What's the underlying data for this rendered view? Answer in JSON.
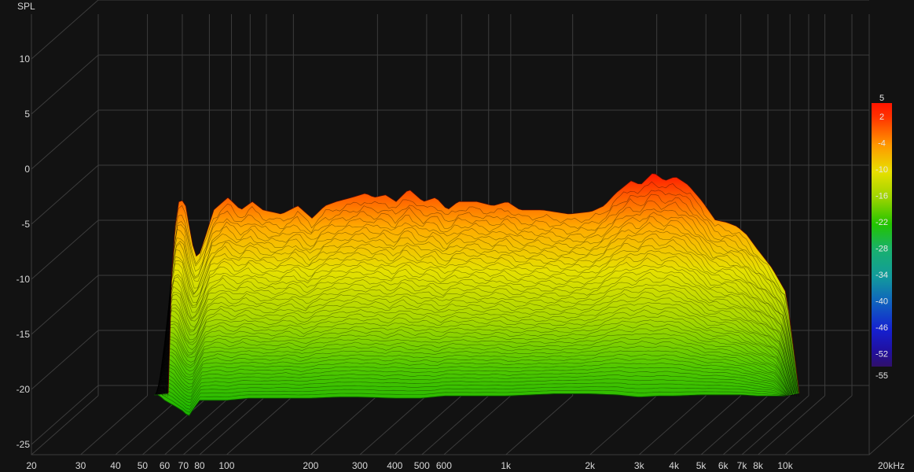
{
  "chart_data": {
    "type": "area",
    "subtype": "waterfall",
    "ylabel": "SPL",
    "x_scale": "log",
    "xlim": [
      20,
      20000
    ],
    "x_ticks": [
      20,
      30,
      40,
      50,
      60,
      70,
      80,
      100,
      200,
      300,
      400,
      500,
      600,
      1000,
      2000,
      3000,
      4000,
      5000,
      6000,
      7000,
      8000,
      10000,
      20000
    ],
    "x_tick_labels": [
      "20",
      "30",
      "40",
      "50",
      "60",
      "70",
      "80",
      "100",
      "200",
      "300",
      "400",
      "500",
      "600",
      "1k",
      "2k",
      "3k",
      "4k",
      "5k",
      "6k",
      "7k",
      "8k",
      "10k",
      "20kHz"
    ],
    "ylim": [
      -25,
      10
    ],
    "y_ticks": [
      10,
      5,
      0,
      -5,
      -10,
      -15,
      -20,
      -25
    ],
    "y_tick_labels": [
      "10",
      "5",
      "0",
      "-5",
      "-10",
      "-15",
      "-20",
      "-25"
    ],
    "frequency_range": [
      55,
      10000
    ],
    "grid": true,
    "colorbar": {
      "position": "right",
      "labels": [
        "5",
        "2",
        "-4",
        "-10",
        "-16",
        "-22",
        "-28",
        "-34",
        "-40",
        "-46",
        "-52",
        "-55"
      ],
      "values": [
        5,
        2,
        -4,
        -10,
        -16,
        -22,
        -28,
        -34,
        -40,
        -46,
        -52,
        -55
      ],
      "colors": [
        "#ff1500",
        "#ff5500",
        "#ffb000",
        "#e5e000",
        "#9bd400",
        "#22c400",
        "#18b070",
        "#129a9c",
        "#1060bf",
        "#1520d0",
        "#2010a0",
        "#30106a"
      ]
    },
    "front_slice": {
      "frequencies": [
        55,
        57,
        60,
        65,
        70,
        73,
        75,
        80,
        90,
        100,
        120,
        150,
        200,
        250,
        300,
        400,
        500,
        600,
        800,
        1000,
        1500,
        2000,
        2500,
        3000,
        3500,
        4000,
        5000,
        6000,
        7000,
        8000,
        10000
      ],
      "spl": [
        -20.5,
        -20.5,
        -21.0,
        -21.5,
        -22.0,
        -22.5,
        -22.0,
        -21.0,
        -21.0,
        -21.0,
        -20.8,
        -20.8,
        -20.8,
        -20.7,
        -20.7,
        -20.8,
        -20.8,
        -20.6,
        -20.6,
        -20.6,
        -20.4,
        -20.4,
        -20.5,
        -20.7,
        -20.6,
        -20.6,
        -20.5,
        -20.5,
        -20.5,
        -20.6,
        -20.6
      ]
    },
    "back_slice": {
      "frequencies": [
        55,
        57,
        60,
        63,
        67,
        70,
        75,
        80,
        90,
        100,
        110,
        120,
        140,
        160,
        180,
        200,
        220,
        250,
        280,
        300,
        330,
        360,
        400,
        450,
        500,
        550,
        600,
        700,
        800,
        900,
        1000,
        1200,
        1500,
        1800,
        2000,
        2200,
        2500,
        2700,
        3000,
        3300,
        3600,
        4000,
        4500,
        5000,
        5500,
        6000,
        6500,
        7000,
        8000,
        9000,
        10000
      ],
      "spl": [
        -20.0,
        -2.0,
        3.0,
        3.2,
        -2.0,
        -4.0,
        -1.0,
        2.0,
        3.5,
        2.0,
        3.0,
        2.0,
        1.5,
        2.5,
        1.0,
        2.5,
        3.0,
        3.5,
        4.0,
        3.5,
        3.8,
        3.0,
        4.5,
        3.0,
        3.5,
        2.0,
        3.0,
        3.0,
        2.5,
        3.0,
        2.0,
        2.0,
        1.5,
        1.8,
        2.5,
        4.0,
        5.5,
        5.0,
        6.5,
        5.5,
        6.0,
        5.0,
        3.0,
        0.8,
        0.5,
        0.0,
        -1.0,
        -2.5,
        -5.0,
        -8.0,
        -20.0
      ]
    }
  }
}
